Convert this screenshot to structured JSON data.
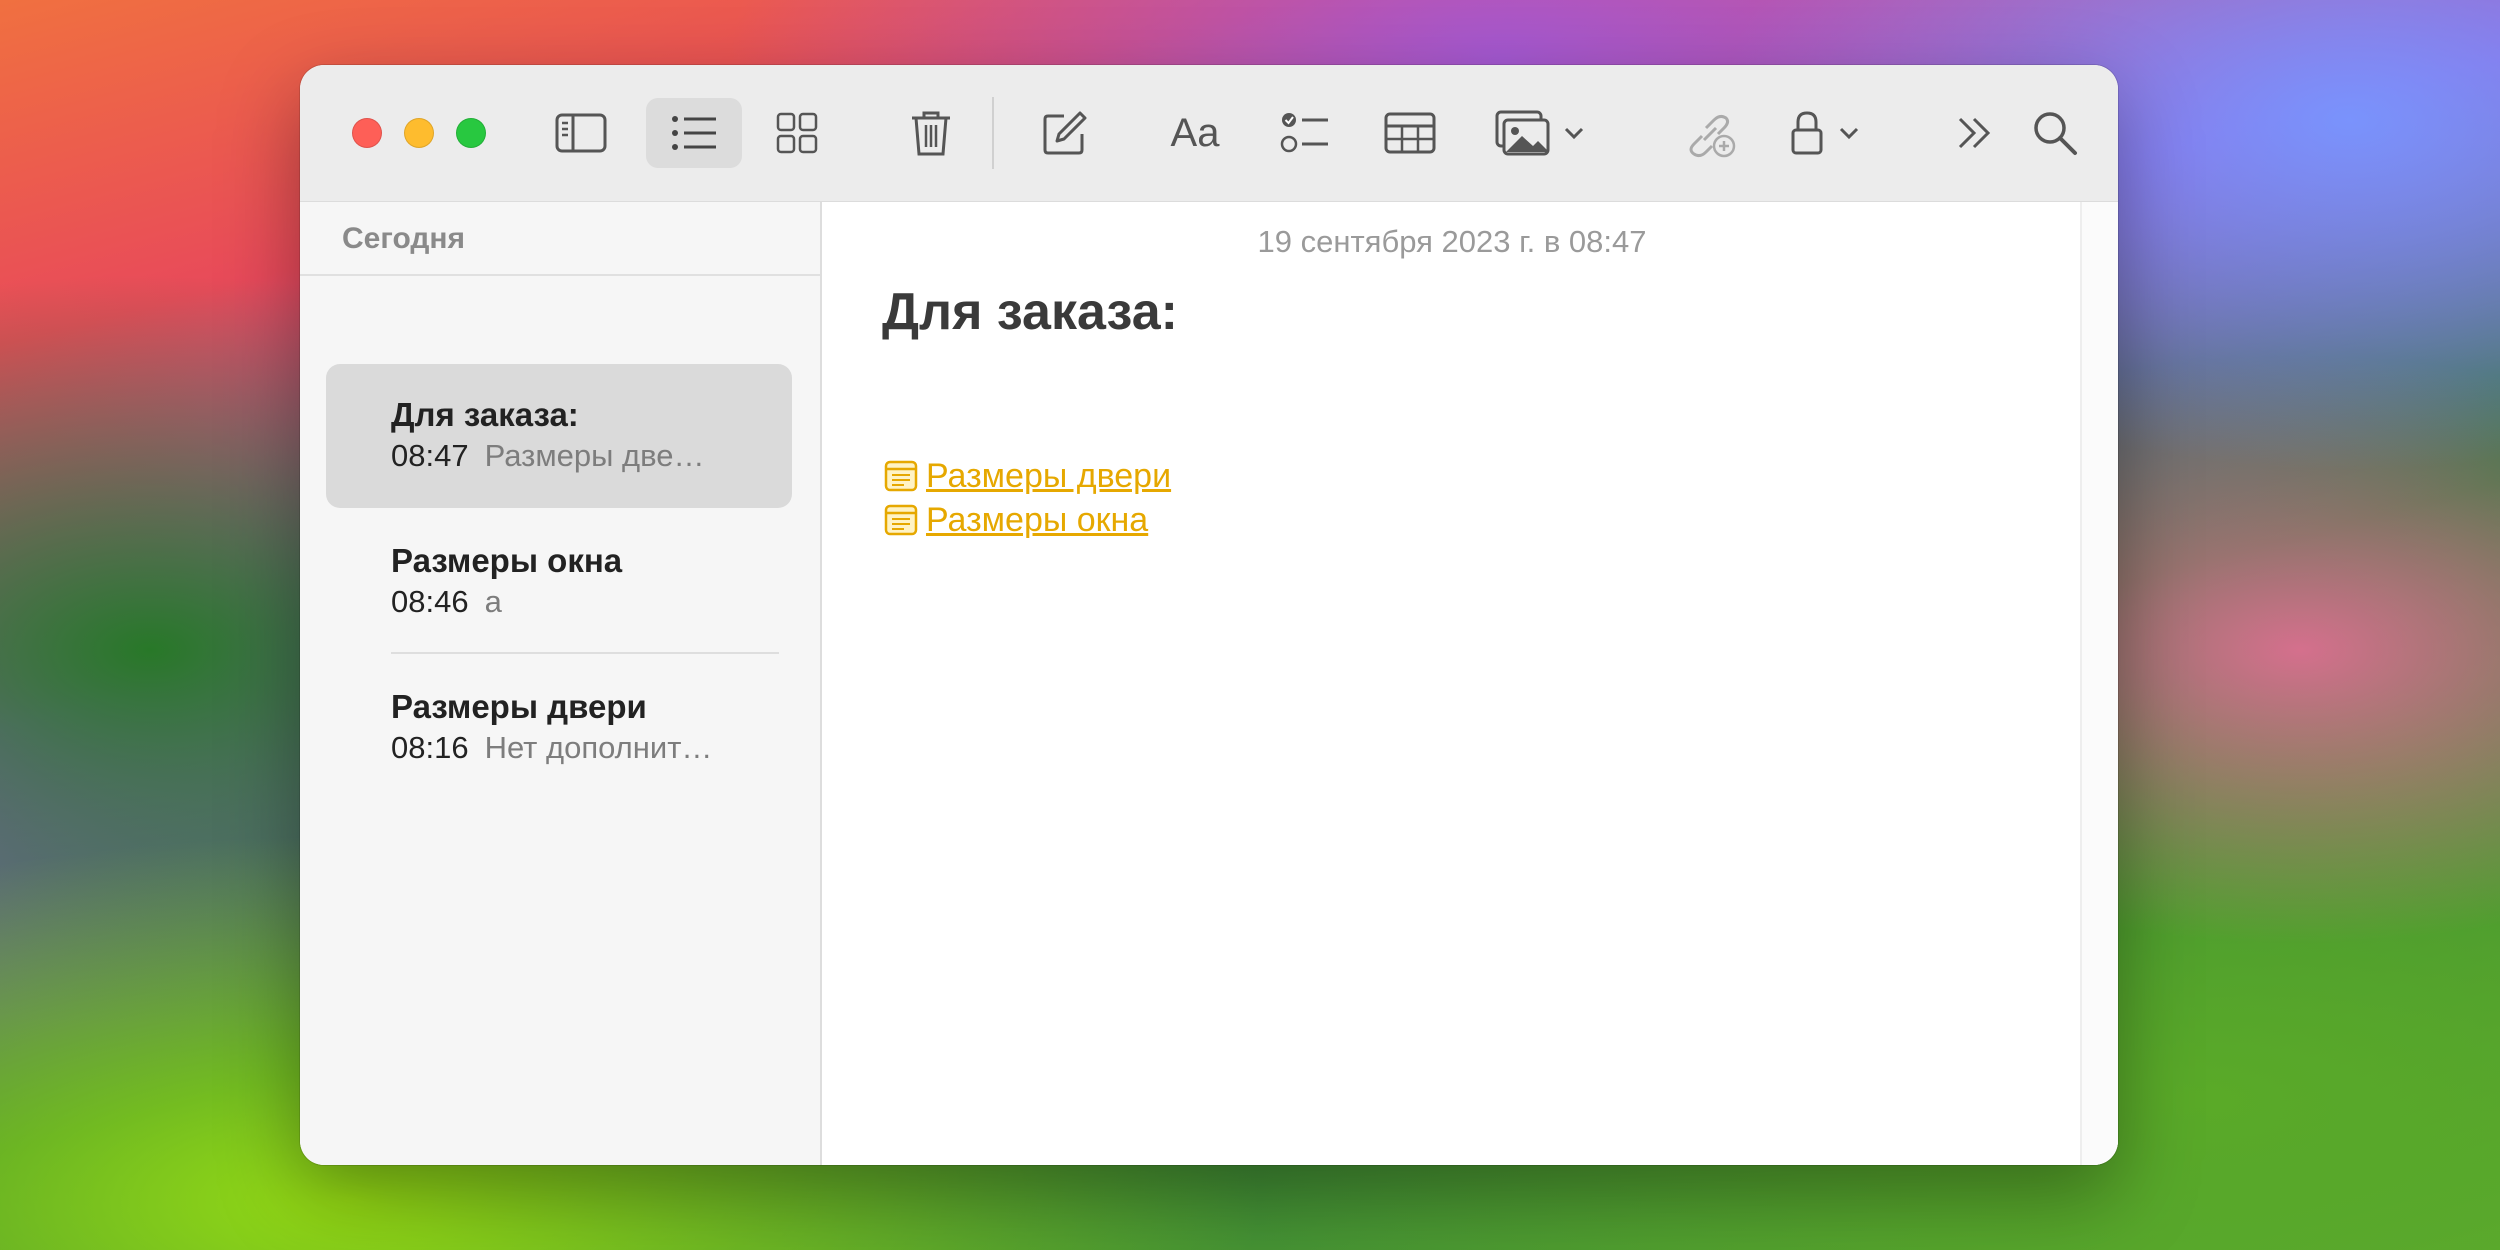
{
  "toolbar": {
    "buttons": [
      {
        "name": "sidebar-toggle",
        "icon": "sidebar-icon"
      },
      {
        "name": "list-view",
        "icon": "list-icon",
        "active": true
      },
      {
        "name": "gallery-view",
        "icon": "grid-icon"
      },
      {
        "name": "delete",
        "icon": "trash-icon"
      },
      {
        "name": "compose",
        "icon": "compose-icon"
      },
      {
        "name": "format",
        "icon": "text-format-icon",
        "label": "Aa"
      },
      {
        "name": "checklist",
        "icon": "checklist-icon"
      },
      {
        "name": "table",
        "icon": "table-icon"
      },
      {
        "name": "media",
        "icon": "photo-icon"
      },
      {
        "name": "collaborate",
        "icon": "link-add-icon"
      },
      {
        "name": "lock",
        "icon": "lock-icon"
      },
      {
        "name": "more",
        "icon": "chevron-double-right-icon"
      },
      {
        "name": "search",
        "icon": "search-icon"
      }
    ],
    "format_label": "Aa"
  },
  "sidebar": {
    "section_title": "Сегодня",
    "notes": [
      {
        "title": "Для заказа:",
        "time": "08:47",
        "preview": "Размеры две…",
        "selected": true
      },
      {
        "title": "Размеры окна",
        "time": "08:46",
        "preview": "a"
      },
      {
        "title": "Размеры двери",
        "time": "08:16",
        "preview": "Нет дополнит…"
      }
    ]
  },
  "note": {
    "date": "19 сентября 2023 г. в 08:47",
    "heading": "Для заказа:",
    "links": [
      {
        "text": "Размеры двери",
        "icon": "note-link-icon"
      },
      {
        "text": "Размеры окна",
        "icon": "note-link-icon"
      }
    ]
  },
  "colors": {
    "accent_link": "#e6a800",
    "traffic_red": "#fe5f57",
    "traffic_yellow": "#febc2e",
    "traffic_green": "#28c840"
  }
}
